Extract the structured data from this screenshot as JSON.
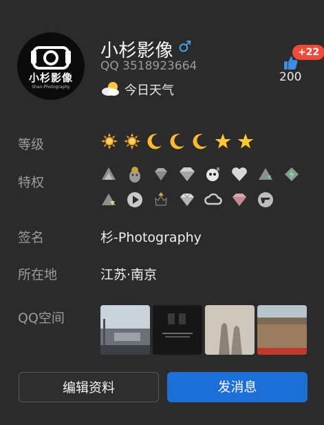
{
  "profile": {
    "nickname": "小杉影像",
    "gender_symbol": "♂",
    "qq_number": "QQ 3518923664",
    "weather_label": "今日天气",
    "avatar_text": "小杉影像",
    "avatar_subtext": "Shan-Photography"
  },
  "likes": {
    "new_badge": "+22",
    "count": "200"
  },
  "rows": {
    "level_label": "等级",
    "privilege_label": "特权",
    "signature_label": "签名",
    "signature_value": "杉-Photography",
    "location_label": "所在地",
    "location_value": "江苏·南京",
    "qzone_label": "QQ空间"
  },
  "level_icons": [
    "sun-icon",
    "sun-icon",
    "moon-icon",
    "moon-icon",
    "moon-icon",
    "star-icon",
    "star-icon"
  ],
  "privilege_icons": {
    "row1": [
      "svip-crown-icon",
      "mascot-icon",
      "diamond-icon",
      "silver-diamond-icon",
      "penguin-bomb-icon",
      "heart-icon",
      "green-diamond-hat-icon",
      "green-lightning-icon"
    ],
    "row2": [
      "yellow-hat-icon",
      "video-play-icon",
      "crown-black-icon",
      "shiny-diamond-icon",
      "cloud-icon",
      "pink-diamond-icon",
      "ff-game-icon"
    ]
  },
  "photo_alt": [
    "street-photo",
    "phone-screenshot-photo",
    "shadows-photo",
    "field-photo"
  ],
  "buttons": {
    "edit_label": "编辑资料",
    "message_label": "发消息"
  },
  "colors": {
    "background": "#2b2b2b",
    "accent_button": "#1b6fd6",
    "badge_red": "#f04a3a",
    "gender_blue": "#3fa9f5"
  }
}
